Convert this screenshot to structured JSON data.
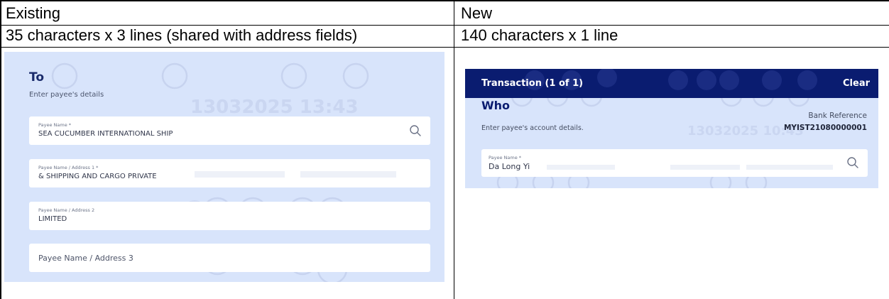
{
  "table": {
    "headers": [
      "Existing",
      "New"
    ],
    "descriptions": [
      "35 characters x 3 lines (shared with address fields)",
      "140 characters x 1 line"
    ]
  },
  "existing_form": {
    "section_title": "To",
    "section_subtitle": "Enter payee's details",
    "watermark": "13032025 13:43",
    "fields": [
      {
        "label": "Payee Name *",
        "value": "SEA CUCUMBER INTERNATIONAL SHIP",
        "has_search": true
      },
      {
        "label": "Payee Name / Address 1 *",
        "value": "& SHIPPING AND CARGO PRIVATE",
        "has_search": false
      },
      {
        "label": "Payee Name / Address 2",
        "value": "LIMITED",
        "has_search": false
      },
      {
        "label": "",
        "placeholder": "Payee Name / Address 3",
        "value": "",
        "has_search": false
      }
    ]
  },
  "new_form": {
    "header_title": "Transaction (1 of 1)",
    "header_action": "Clear",
    "section_title": "Who",
    "section_subtitle": "Enter payee's account details.",
    "watermark": "13032025 10:43",
    "bank_reference_label": "Bank Reference",
    "bank_reference_value": "MYIST21080000001",
    "field": {
      "label": "Payee Name *",
      "value": "Da Long Yi",
      "has_search": true
    }
  },
  "colors": {
    "panel_bg": "#d8e4fb",
    "header_bg": "#0a1c70",
    "title_navy": "#1a2b6b",
    "field_bg": "#ffffff"
  },
  "icons": [
    "search-icon"
  ]
}
